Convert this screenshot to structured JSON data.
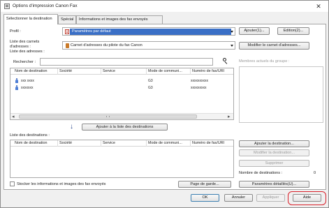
{
  "window": {
    "title": "Options d'impression Canon Fax",
    "close_glyph": "✕"
  },
  "tabs": [
    {
      "label": "Sélectionner la destination",
      "active": true
    },
    {
      "label": "Spécial",
      "active": false
    },
    {
      "label": "Informations et images des fax envoyés",
      "active": false
    }
  ],
  "profile": {
    "label": "Profil :",
    "value": "Paramètres par défaut",
    "icon": "profile-icon",
    "add_button": "Ajouter(1)...",
    "edit_button": "Edition(2)..."
  },
  "address_book": {
    "label_line1": "Liste des carnets",
    "label_line2": "d'adresses :",
    "value": "Carnet d'adresses du pilote du fax Canon",
    "icon": "address-book-icon",
    "modify_button": "Modifier le carnet d'adresses..."
  },
  "address_list": {
    "label": "Liste des adresses :",
    "search_label": "Rechercher :",
    "search_value": "",
    "search_icon": "magnifier-icon",
    "columns": [
      "Nom de destination",
      "Société",
      "Service",
      "Mode de communi...",
      "Numéro de fax/URI"
    ],
    "rows": [
      {
        "name": "xxx xxxx",
        "company": "",
        "department": "",
        "mode": "G3",
        "number": "xxxxxxxxxx"
      },
      {
        "name": "xxxxxxx",
        "company": "",
        "department": "",
        "mode": "G3",
        "number": "xxxxxxxxx"
      }
    ],
    "scroll_left": "◂",
    "scroll_right": "▸"
  },
  "group_members": {
    "label": "Membres actuels du groupe :"
  },
  "add_to_list": {
    "arrow": "↓",
    "button": "Ajouter à la liste des destinations"
  },
  "destination_list": {
    "label": "Liste des destinations :",
    "columns": [
      "Nom de destination",
      "Société",
      "Service",
      "Mode de communi...",
      "Numéro de fax/URI"
    ],
    "add_button": "Ajouter la destination...",
    "modify_button": "Modifier la destination...",
    "delete_button": "Supprimer",
    "count_label": "Nombre de destinations :",
    "count_value": "0"
  },
  "footer": {
    "store_checkbox_label": "Stocker les informations et images des fax envoyés",
    "store_checked": false,
    "cover_page_button": "Page de garde...",
    "detailed_settings_button": "Paramètres détaillés(U)..."
  },
  "dialog_buttons": {
    "ok": "OK",
    "cancel": "Annuler",
    "apply": "Appliquer",
    "help": "Aide"
  },
  "colors": {
    "selection_outline": "#d9202a",
    "panel_bg": "#ffffff",
    "window_bg": "#f0f0f0"
  }
}
